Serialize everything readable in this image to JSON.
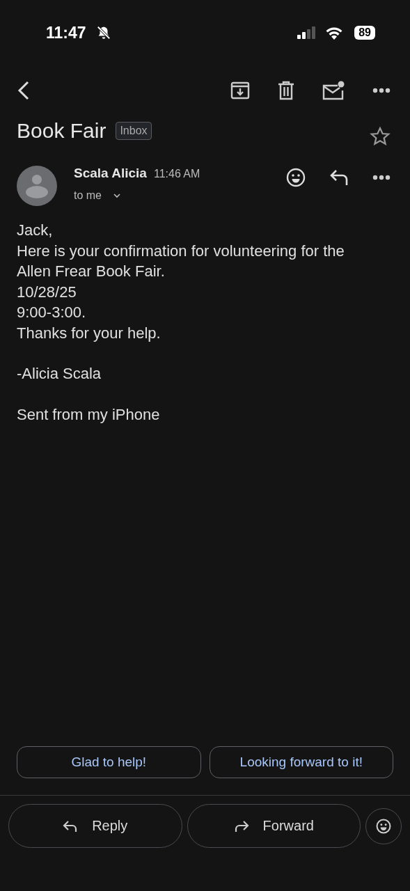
{
  "status_bar": {
    "time": "11:47",
    "battery": "89"
  },
  "subject": {
    "title": "Book Fair",
    "label": "Inbox",
    "starred": false
  },
  "message": {
    "sender": "Scala Alicia",
    "time": "11:46 AM",
    "recipient": "to me",
    "paragraphs": [
      [
        "Jack,",
        "Here is your confirmation for volunteering for the",
        "Allen Frear Book Fair.",
        "10/28/25",
        "9:00-3:00.",
        "Thanks for your help."
      ],
      [
        "-Alicia Scala"
      ],
      [
        "Sent from my iPhone"
      ]
    ]
  },
  "smart_replies": [
    "Glad to help!",
    "Looking forward to it!"
  ],
  "actions": [
    {
      "label": "Reply",
      "kind": "reply"
    },
    {
      "label": "Forward",
      "kind": "forward"
    }
  ]
}
